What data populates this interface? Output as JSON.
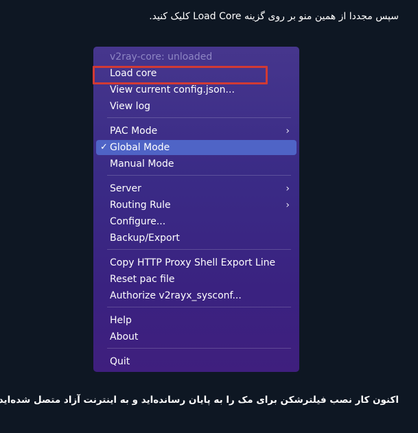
{
  "captions": {
    "top": "سپس مجددا از همین منو بر روی گزینه Load Core کلیک کنید.",
    "bottom": "اکنون کار نصب فیلترشکن برای مک را به پایان رسانده‌اید و به اینترنت آزاد متصل شده‌اید."
  },
  "menu": {
    "status": "v2ray-core: unloaded",
    "load_core": "Load core",
    "view_config": "View current config.json...",
    "view_log": "View log",
    "pac_mode": "PAC Mode",
    "global_mode": "Global Mode",
    "manual_mode": "Manual Mode",
    "server": "Server",
    "routing_rule": "Routing Rule",
    "configure": "Configure...",
    "backup_export": "Backup/Export",
    "copy_http_proxy": "Copy HTTP Proxy Shell Export Line",
    "reset_pac": "Reset pac file",
    "authorize": "Authorize v2rayx_sysconf...",
    "help": "Help",
    "about": "About",
    "quit": "Quit",
    "checkmark": "✓",
    "submenu_glyph": "›"
  },
  "colors": {
    "page_bg": "#0e1723",
    "menu_selected": "#4f64c6",
    "annotation_box": "#d23a34"
  },
  "icons": {
    "check": "checkmark-icon",
    "submenu": "chevron-right-icon"
  }
}
